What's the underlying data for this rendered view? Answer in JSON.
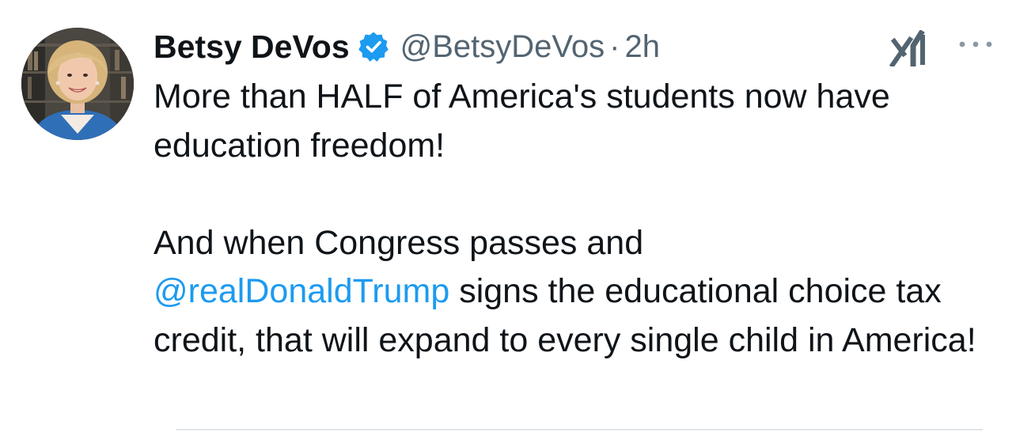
{
  "author": {
    "display_name": "Betsy DeVos",
    "handle": "@BetsyDeVos",
    "separator": "·",
    "timestamp": "2h",
    "verified": true,
    "avatar_icon": "profile-photo"
  },
  "tweet": {
    "paragraph1": "More than HALF of America's students now have education freedom!",
    "paragraph2_before": "And when Congress passes and",
    "mention": "@realDonaldTrump",
    "paragraph2_after": "signs the educational choice tax credit, that will expand to every single child in America!"
  },
  "actions": {
    "grok_icon": "grok-icon",
    "more_icon": "more-options-icon"
  },
  "colors": {
    "text": "#0f1419",
    "secondary": "#536471",
    "link": "#1d9bf0",
    "verified": "#1d9bf0",
    "divider": "#e1e6ea"
  }
}
